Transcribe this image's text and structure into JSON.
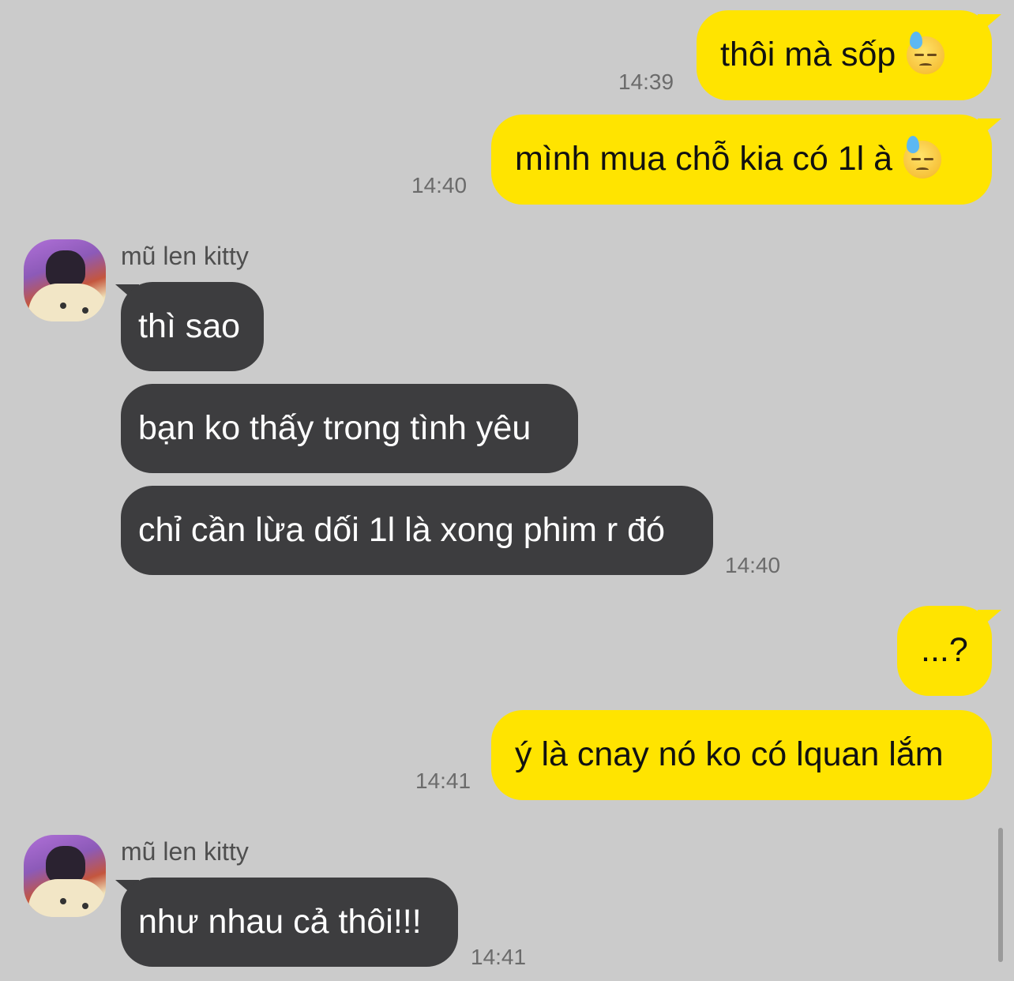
{
  "messages": [
    {
      "direction": "out",
      "text": "thôi mà sốp",
      "emoji": "downcast-face-with-sweat-icon",
      "time": "14:39"
    },
    {
      "direction": "out",
      "text": "mình mua chỗ kia có 1l à",
      "emoji": "downcast-face-with-sweat-icon",
      "time": "14:40"
    },
    {
      "direction": "in",
      "sender": "mũ len kitty",
      "text": "thì sao"
    },
    {
      "direction": "in",
      "text": "bạn ko thấy trong tình yêu"
    },
    {
      "direction": "in",
      "text": "chỉ cần lừa dối 1l là xong phim r đó",
      "time": "14:40"
    },
    {
      "direction": "out",
      "text": "...?"
    },
    {
      "direction": "out",
      "text": "ý là cnay nó ko có lquan lắm",
      "time": "14:41"
    },
    {
      "direction": "in",
      "sender": "mũ len kitty",
      "text": "như nhau cả thôi!!!",
      "time": "14:41"
    }
  ],
  "colors": {
    "background": "#cbcbcb",
    "outgoing_bubble": "#ffe400",
    "incoming_bubble": "#3d3d3f",
    "timestamp": "#6b6b6b"
  }
}
